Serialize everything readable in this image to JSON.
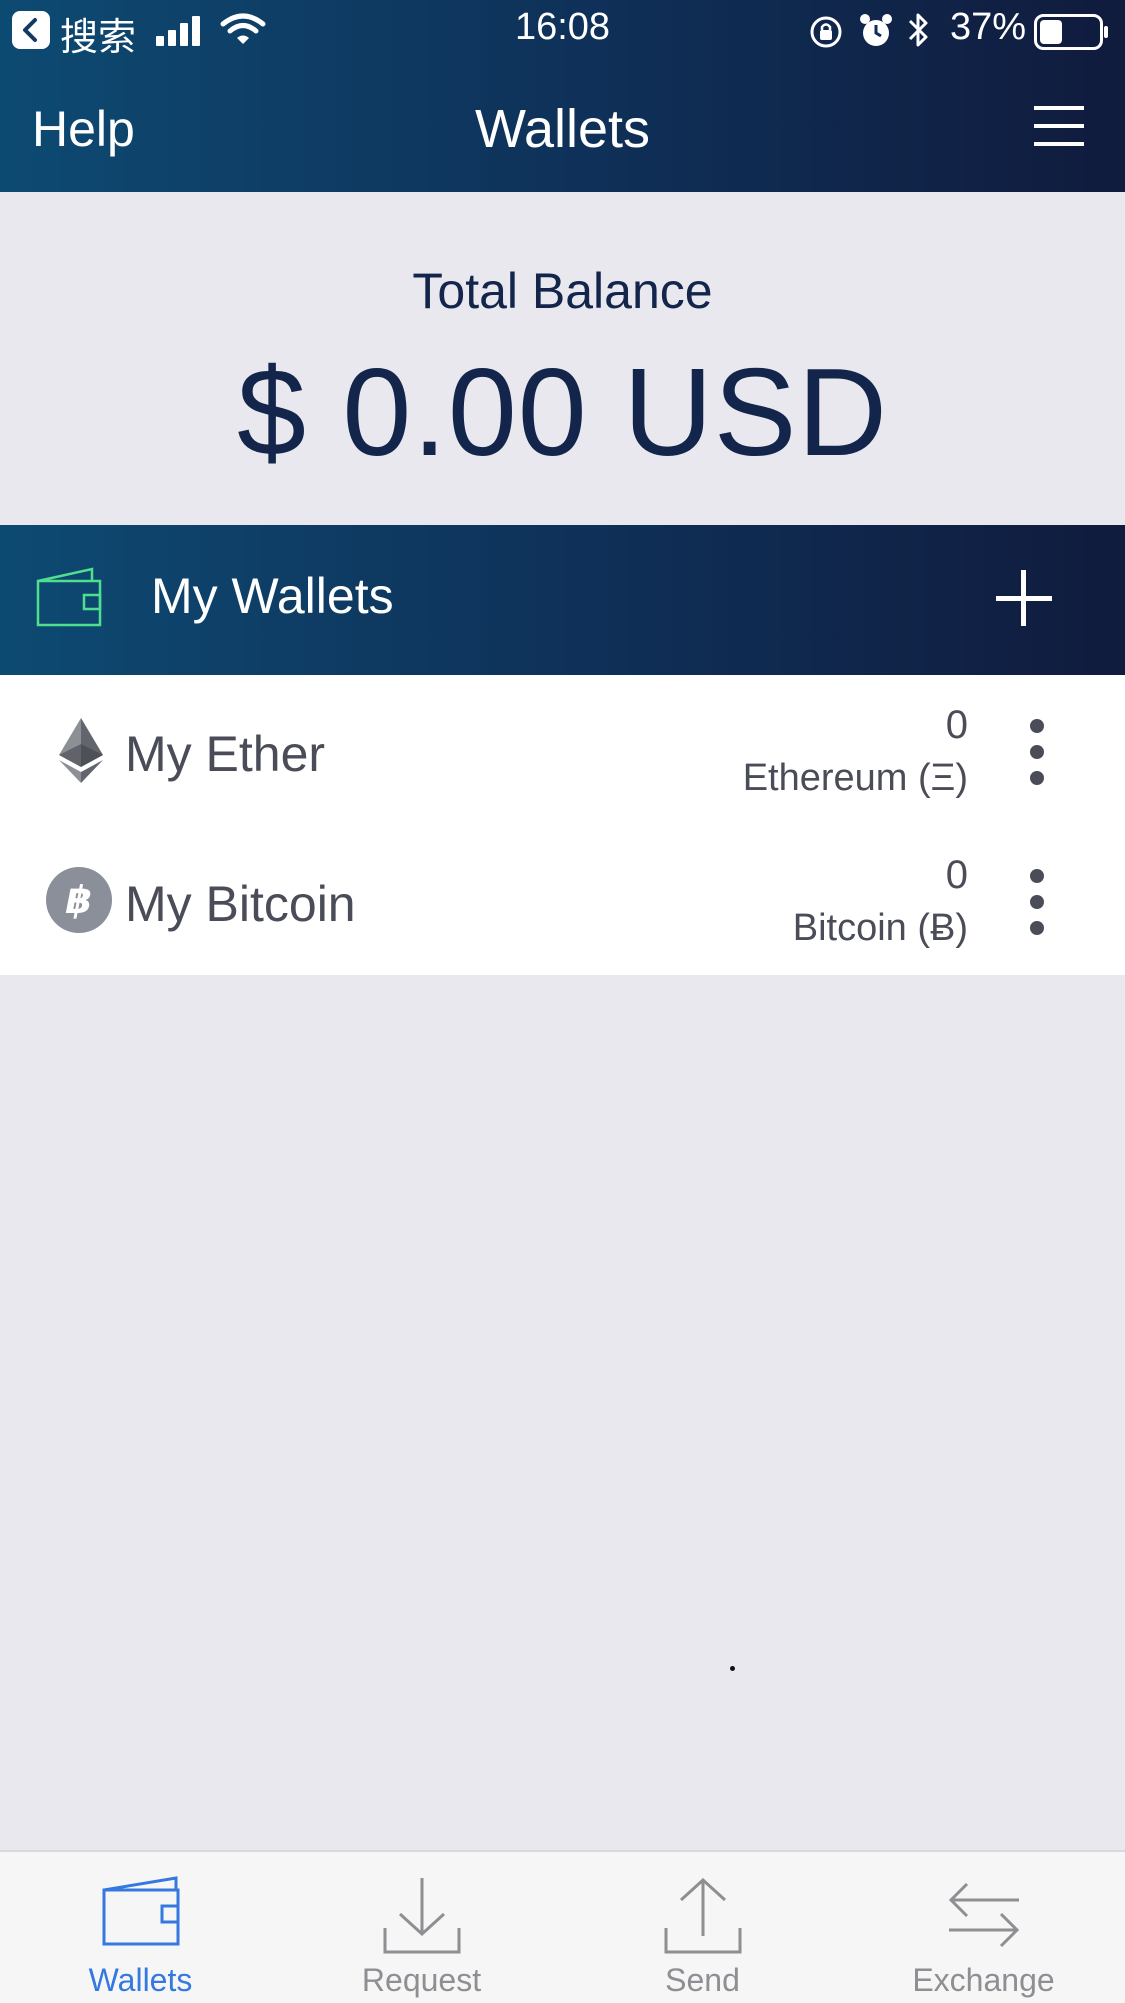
{
  "status_bar": {
    "back_label": "搜索",
    "time": "16:08",
    "battery": "37%",
    "icons": [
      "back-icon",
      "signal-icon",
      "wifi-icon",
      "rotation-lock-icon",
      "alarm-icon",
      "bluetooth-icon",
      "battery-icon"
    ]
  },
  "nav": {
    "help": "Help",
    "title": "Wallets",
    "menu_icon": "hamburger-menu-icon"
  },
  "balance": {
    "label": "Total Balance",
    "amount": "$ 0.00 USD"
  },
  "wallets_header": {
    "label": "My Wallets",
    "wallet_icon": "wallet-icon",
    "add_icon": "plus-icon"
  },
  "wallets": [
    {
      "name": "My Ether",
      "amount": "0",
      "currency": "Ethereum (Ξ)",
      "icon": "ethereum-icon"
    },
    {
      "name": "My Bitcoin",
      "amount": "0",
      "currency": "Bitcoin (Ƀ)",
      "icon": "bitcoin-icon"
    }
  ],
  "tabs": [
    {
      "label": "Wallets",
      "icon": "wallet-icon",
      "active": true
    },
    {
      "label": "Request",
      "icon": "download-icon",
      "active": false
    },
    {
      "label": "Send",
      "icon": "upload-icon",
      "active": false
    },
    {
      "label": "Exchange",
      "icon": "exchange-icon",
      "active": false
    }
  ],
  "colors": {
    "header_gradient_start": "#0d4a72",
    "header_gradient_end": "#101b3d",
    "balance_text": "#13254a",
    "wallet_icon_accent": "#4ee08f",
    "tab_active": "#3478e0",
    "tab_inactive": "#8e8e93",
    "bitcoin_badge": "#8a8f99"
  }
}
